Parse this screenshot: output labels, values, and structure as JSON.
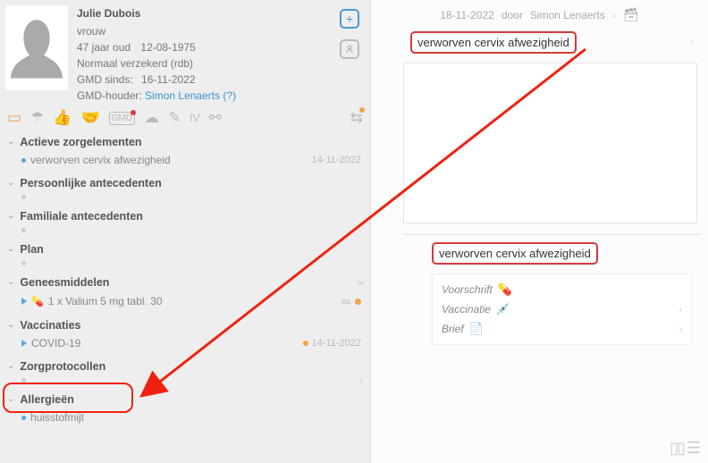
{
  "patient": {
    "name": "Julie Dubois",
    "gender": "vrouw",
    "age": "47 jaar oud",
    "dob": "12-08-1975",
    "insurance": "Normaal verzekerd (rdb)",
    "gmd_since_label": "GMD sinds:",
    "gmd_since": "16-11-2022",
    "gmd_holder_label": "GMD-houder:",
    "gmd_holder": "Simon Lenaerts (?)"
  },
  "sections": {
    "active": {
      "title": "Actieve zorgelementen",
      "item": "verworven cervix afwezigheid",
      "date": "14-11-2022"
    },
    "personal": {
      "title": "Persoonlijke antecedenten"
    },
    "family": {
      "title": "Familiale antecedenten"
    },
    "plan": {
      "title": "Plan"
    },
    "meds": {
      "title": "Geneesmiddelen",
      "item": "1 x Valium 5 mg tabl. 30"
    },
    "vacc": {
      "title": "Vaccinaties",
      "item": "COVID-19",
      "date": "14-11-2022"
    },
    "protocols": {
      "title": "Zorgprotocollen"
    },
    "allergies": {
      "title": "Allergieën",
      "item": "huisstofmijt"
    }
  },
  "contact": {
    "date": "18-11-2022",
    "by_label": "door",
    "author": "Simon Lenaerts",
    "diag1": "verworven cervix afwezigheid",
    "diag2": "verworven cervix afwezigheid",
    "actions": {
      "rx": "Voorschrift",
      "vacc": "Vaccinatie",
      "letter": "Brief"
    }
  }
}
